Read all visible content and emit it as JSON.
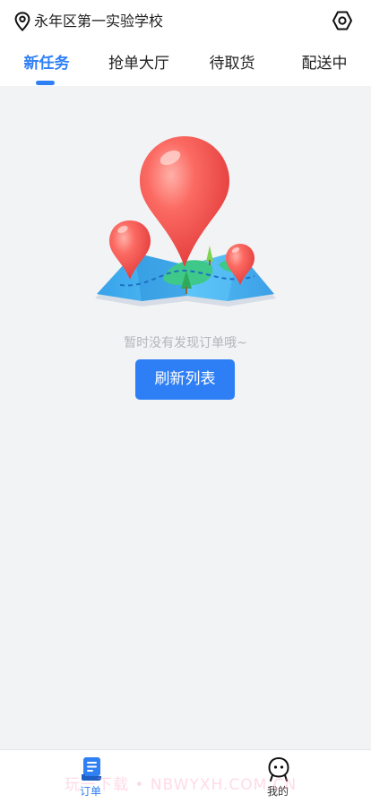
{
  "header": {
    "location_icon": "location-pin-icon",
    "location": "永年区第一实验学校",
    "settings_icon": "hexagon-settings-icon"
  },
  "tabs": [
    {
      "label": "新任务",
      "active": true
    },
    {
      "label": "抢单大厅",
      "active": false
    },
    {
      "label": "待取货",
      "active": false
    },
    {
      "label": "配送中",
      "active": false
    }
  ],
  "empty_state": {
    "illustration": "map-with-location-pins",
    "message": "暂时没有发现订单哦~",
    "refresh_button": "刷新列表"
  },
  "bottom_nav": [
    {
      "label": "订单",
      "icon": "order-document-icon",
      "active": true
    },
    {
      "label": "我的",
      "icon": "profile-face-icon",
      "active": false
    }
  ],
  "watermark": "玩一下载 • NBWYXH.COM.CN",
  "colors": {
    "accent": "#2f7ff5",
    "background": "#f2f3f5",
    "pin_red": "#f24f4f",
    "map_blue": "#3fa8ec",
    "map_green": "#4fcf8f"
  }
}
